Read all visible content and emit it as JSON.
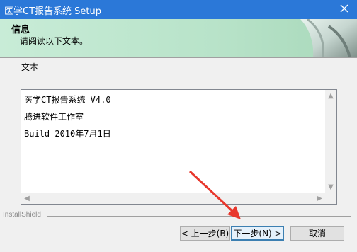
{
  "window": {
    "title": "医学CT报告系统 Setup"
  },
  "header": {
    "title": "信息",
    "subtitle": "请阅读以下文本。"
  },
  "main": {
    "label": "文本",
    "text_lines": [
      "医学CT报告系统 V4.0",
      "腾进软件工作室",
      "Build 2010年7月1日"
    ]
  },
  "footer": {
    "brand": "InstallShield",
    "buttons": {
      "back": "< 上一步(B)",
      "next": "下一步(N) >",
      "cancel": "取消"
    }
  },
  "colors": {
    "titlebar": "#2b78d8",
    "header_bg": "#c8ecd7",
    "annotation_arrow": "#e8372c"
  },
  "icons": {
    "close": "close-icon",
    "scroll_up": "chevron-up-icon",
    "scroll_down": "chevron-down-icon",
    "scroll_left": "chevron-left-icon",
    "scroll_right": "chevron-right-icon"
  }
}
